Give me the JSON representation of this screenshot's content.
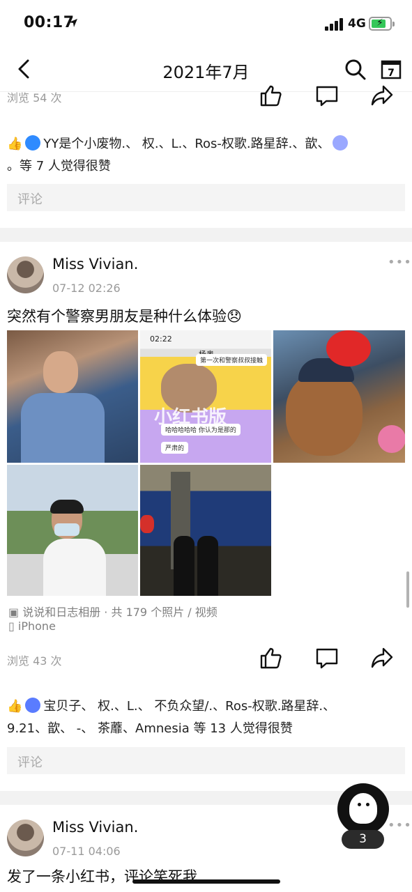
{
  "status_bar": {
    "time": "00:17",
    "network": "4G"
  },
  "nav": {
    "title": "2021年7月"
  },
  "post_prev": {
    "views": "浏览 54 次",
    "likes_text_line1": "YY是个小废物.、 权.、L.、Ros-权歌.路星辞.、歆、",
    "likes_text_line2": "。等 7 人觉得很赞",
    "comment_placeholder": "评论"
  },
  "post_main": {
    "author": "Miss Vivian.",
    "date": "07-12 02:26",
    "text": "突然有个警察男朋友是种什么体验😞",
    "photo_texts": {
      "time": "02:22",
      "chat_name": "杨奥",
      "bubble1": "第一次和警察叔叔接触",
      "bubble2": "哈哈哈哈哈  你认为是那的",
      "bubble3": "严肃的",
      "watermark": "小红书版"
    },
    "album": "说说和日志相册 · 共 179 个照片 / 视频",
    "device": "iPhone",
    "views": "浏览 43 次",
    "likes_text_line1": "宝贝子、 权.、L.、 不负众望/.、Ros-权歌.路星辞.、",
    "likes_text_line2": "9.21、歆、 -、 茶蘼、Amnesia 等 13 人觉得很赞",
    "comment_placeholder": "评论"
  },
  "post_next": {
    "author": "Miss Vivian.",
    "date": "07-11 04:06",
    "text": "发了一条小红书，评论笑死我"
  },
  "fab": {
    "count": "3"
  },
  "colors": {
    "battery_green": "#34c759",
    "badge_blue": "#2f8bff",
    "badge_pink": "#e8388a",
    "badge_orange": "#f08a24"
  }
}
